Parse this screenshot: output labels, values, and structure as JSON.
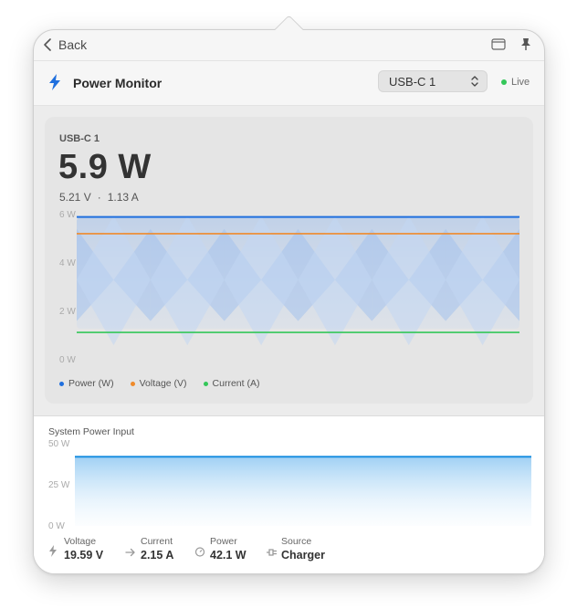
{
  "topbar": {
    "back_label": "Back"
  },
  "header": {
    "title": "Power Monitor",
    "port_select": "USB-C 1",
    "live_label": "Live"
  },
  "colors": {
    "power": "#1f6fde",
    "voltage": "#ef8a2b",
    "current": "#34c759",
    "system": "#1a8fe0",
    "live": "#34c759"
  },
  "port_card": {
    "label": "USB-C 1",
    "power_value": "5.9 W",
    "voltage_value": "5.21 V",
    "separator": "·",
    "current_value": "1.13 A",
    "legend": [
      "Power (W)",
      "Voltage (V)",
      "Current (A)"
    ]
  },
  "chart_data": [
    {
      "type": "line",
      "title": "",
      "ylim": [
        0,
        6
      ],
      "yticks": [
        "0 W",
        "2 W",
        "4 W",
        "6 W"
      ],
      "grid": false,
      "legend_position": "bottom-left",
      "series": [
        {
          "name": "Power (W)",
          "values": [
            5.9,
            5.9
          ]
        },
        {
          "name": "Voltage (V)",
          "values": [
            5.21,
            5.21
          ]
        },
        {
          "name": "Current (A)",
          "values": [
            1.13,
            1.13
          ]
        }
      ]
    },
    {
      "type": "area",
      "title": "System Power Input",
      "ylim": [
        0,
        50
      ],
      "yticks": [
        "0 W",
        "25 W",
        "50 W"
      ],
      "grid": false,
      "series": [
        {
          "values": [
            42.1,
            42.1
          ]
        }
      ]
    }
  ],
  "system": {
    "label": "System Power Input",
    "stats": [
      {
        "icon": "bolt-icon",
        "label": "Voltage",
        "value": "19.59 V"
      },
      {
        "icon": "arrow-right-icon",
        "label": "Current",
        "value": "2.15 A"
      },
      {
        "icon": "power-meter-icon",
        "label": "Power",
        "value": "42.1 W"
      },
      {
        "icon": "plug-icon",
        "label": "Source",
        "value": "Charger"
      }
    ]
  }
}
